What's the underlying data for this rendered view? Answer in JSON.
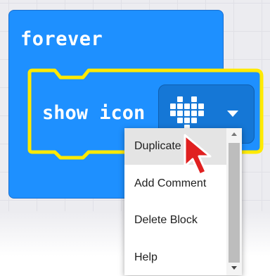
{
  "workspace": {
    "forever_block": {
      "label": "forever",
      "color": "#1e90ff"
    },
    "show_icon_block": {
      "label": "show icon",
      "highlight_color": "#ffea00",
      "icon": "heart-grid-icon",
      "dropdown": "chevron-down-icon"
    }
  },
  "context_menu": {
    "items": [
      {
        "label": "Duplicate",
        "highlighted": true
      },
      {
        "label": "Add Comment",
        "highlighted": false
      },
      {
        "label": "Delete Block",
        "highlighted": false
      },
      {
        "label": "Help",
        "highlighted": false
      }
    ],
    "scrollbar": {
      "up_icon": "scroll-up-arrow-icon",
      "down_icon": "scroll-down-arrow-icon"
    }
  },
  "cursor": {
    "icon": "mouse-pointer-icon",
    "color": "#e02020"
  }
}
